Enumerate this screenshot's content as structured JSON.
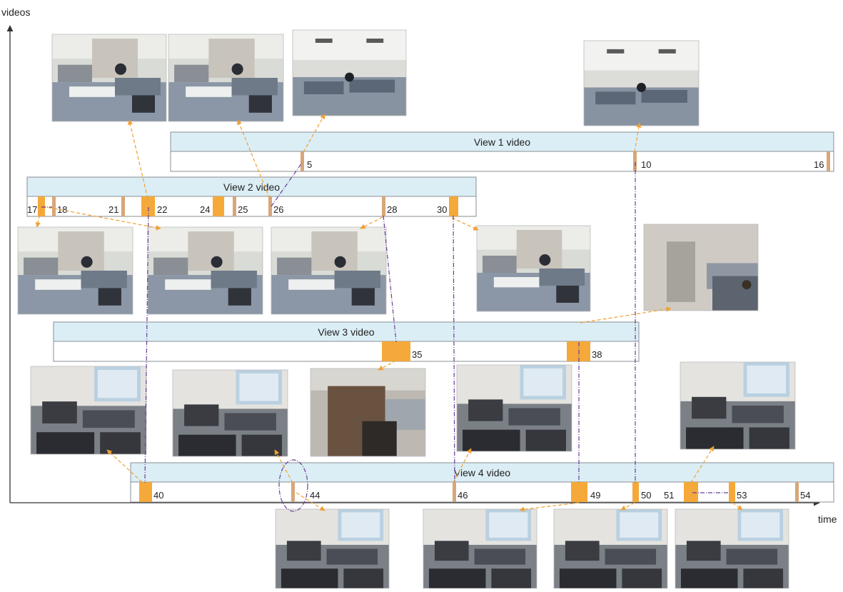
{
  "axes": {
    "y_label": "videos",
    "x_label": "time"
  },
  "colors": {
    "track_header": "#dbeef5",
    "track_border": "#8a8f94",
    "segment": "#f4a93a",
    "segment_thin": "#d7a77a",
    "orange_link": "#f0a030",
    "purple_link": "#6a3c9a"
  },
  "tracks": [
    {
      "title": "View 1 video",
      "markers": [
        {
          "label": "5"
        },
        {
          "label": "10"
        },
        {
          "label": "16"
        }
      ]
    },
    {
      "title": "View 2 video",
      "markers": [
        {
          "label": "17"
        },
        {
          "label": "18"
        },
        {
          "label": "21"
        },
        {
          "label": "22"
        },
        {
          "label": "24"
        },
        {
          "label": "25"
        },
        {
          "label": "26"
        },
        {
          "label": "28"
        },
        {
          "label": "30"
        }
      ]
    },
    {
      "title": "View 3 video",
      "markers": [
        {
          "label": "35"
        },
        {
          "label": "38"
        }
      ]
    },
    {
      "title": "View 4 video",
      "markers": [
        {
          "label": "40"
        },
        {
          "label": "44"
        },
        {
          "label": "46"
        },
        {
          "label": "49"
        },
        {
          "label": "50"
        },
        {
          "label": "51"
        },
        {
          "label": "53"
        },
        {
          "label": "54"
        }
      ]
    }
  ],
  "frames": [
    {
      "id": "f1",
      "scene": "officeA"
    },
    {
      "id": "f2",
      "scene": "officeA"
    },
    {
      "id": "f3",
      "scene": "officeWide"
    },
    {
      "id": "f4",
      "scene": "officeWide"
    },
    {
      "id": "f5",
      "scene": "officeA"
    },
    {
      "id": "f6",
      "scene": "officeA"
    },
    {
      "id": "f7",
      "scene": "officeA"
    },
    {
      "id": "f8",
      "scene": "officeA"
    },
    {
      "id": "f9",
      "scene": "corridor"
    },
    {
      "id": "f10",
      "scene": "officeB"
    },
    {
      "id": "f11",
      "scene": "officeB"
    },
    {
      "id": "f12",
      "scene": "door"
    },
    {
      "id": "f13",
      "scene": "officeB"
    },
    {
      "id": "f14",
      "scene": "officeB"
    },
    {
      "id": "f15",
      "scene": "officeB"
    },
    {
      "id": "f16",
      "scene": "officeB"
    },
    {
      "id": "f17",
      "scene": "officeB"
    },
    {
      "id": "f18",
      "scene": "officeB"
    }
  ]
}
